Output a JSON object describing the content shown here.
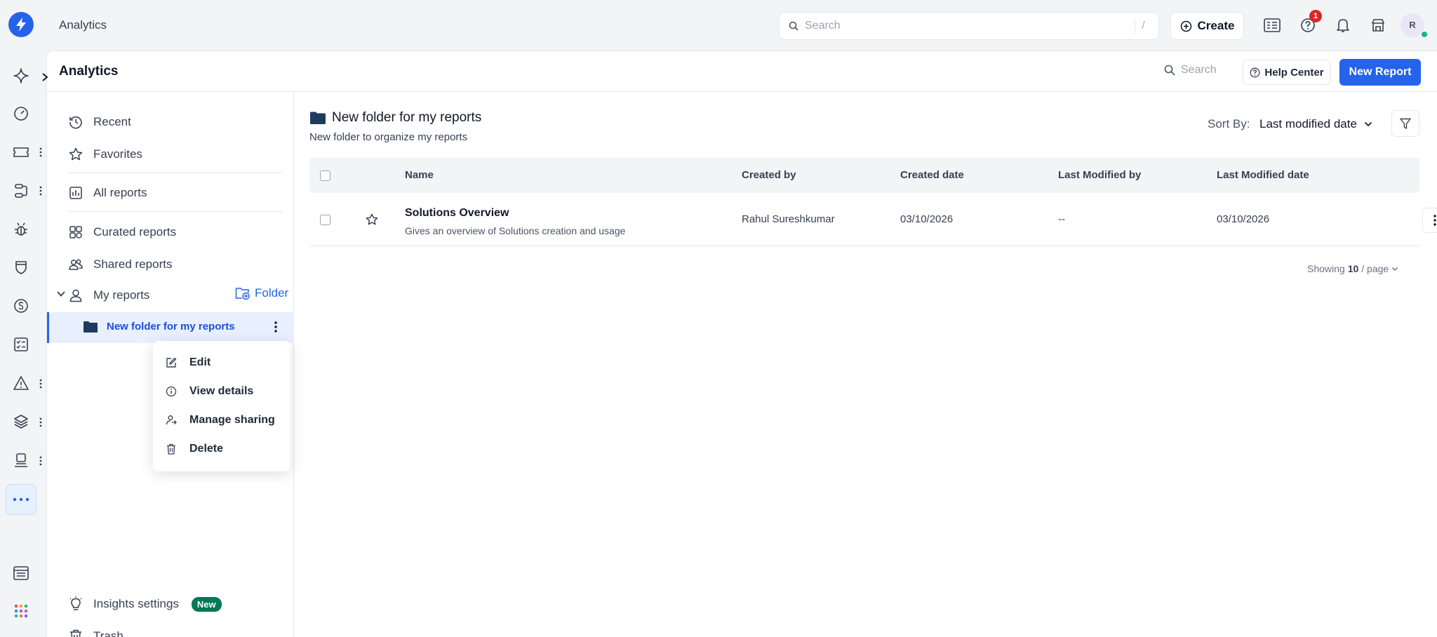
{
  "topbar": {
    "title": "Analytics",
    "search_placeholder": "Search",
    "search_shortcut": "/",
    "create_label": "Create",
    "notification_count": "1",
    "avatar_initial": "R"
  },
  "header": {
    "title": "Analytics",
    "search_label": "Search",
    "help_label": "Help Center",
    "new_report_label": "New Report"
  },
  "sidebar": {
    "recent": "Recent",
    "favorites": "Favorites",
    "all_reports": "All reports",
    "curated": "Curated reports",
    "shared": "Shared reports",
    "my_reports": "My reports",
    "folder_action": "Folder",
    "selected_folder": "New folder for my reports",
    "insights": "Insights settings",
    "new_badge": "New",
    "trash": "Trash"
  },
  "context_menu": {
    "items": [
      "Edit",
      "View details",
      "Manage sharing",
      "Delete"
    ]
  },
  "content": {
    "folder_title": "New folder for my reports",
    "folder_description": "New folder to organize my reports",
    "sort_label": "Sort By:",
    "sort_value": "Last modified date",
    "columns": [
      "Name",
      "Created by",
      "Created date",
      "Last Modified by",
      "Last Modified date"
    ],
    "rows": [
      {
        "name": "Solutions Overview",
        "description": "Gives an overview of Solutions creation and usage",
        "created_by": "Rahul Sureshkumar",
        "created_date": "03/10/2026",
        "modified_by": "--",
        "modified_date": "03/10/2026"
      }
    ],
    "pager_prefix": "Showing",
    "pager_count": "10",
    "pager_suffix": "/ page"
  },
  "colors": {
    "accent": "#2563eb",
    "selected_bg": "#e8f0fe",
    "badge_red": "#dc2626",
    "new_badge_green": "#047857",
    "online_green": "#10b981"
  },
  "icons": {
    "rail": [
      "sparkle-icon",
      "gauge-icon",
      "ticket-icon",
      "workflow-icon",
      "bug-icon",
      "shield-icon",
      "dollar-icon",
      "checklist-icon",
      "alert-icon",
      "layers-icon",
      "agent-icon",
      "more-icon",
      "grid-icon",
      "apps-icon"
    ]
  }
}
